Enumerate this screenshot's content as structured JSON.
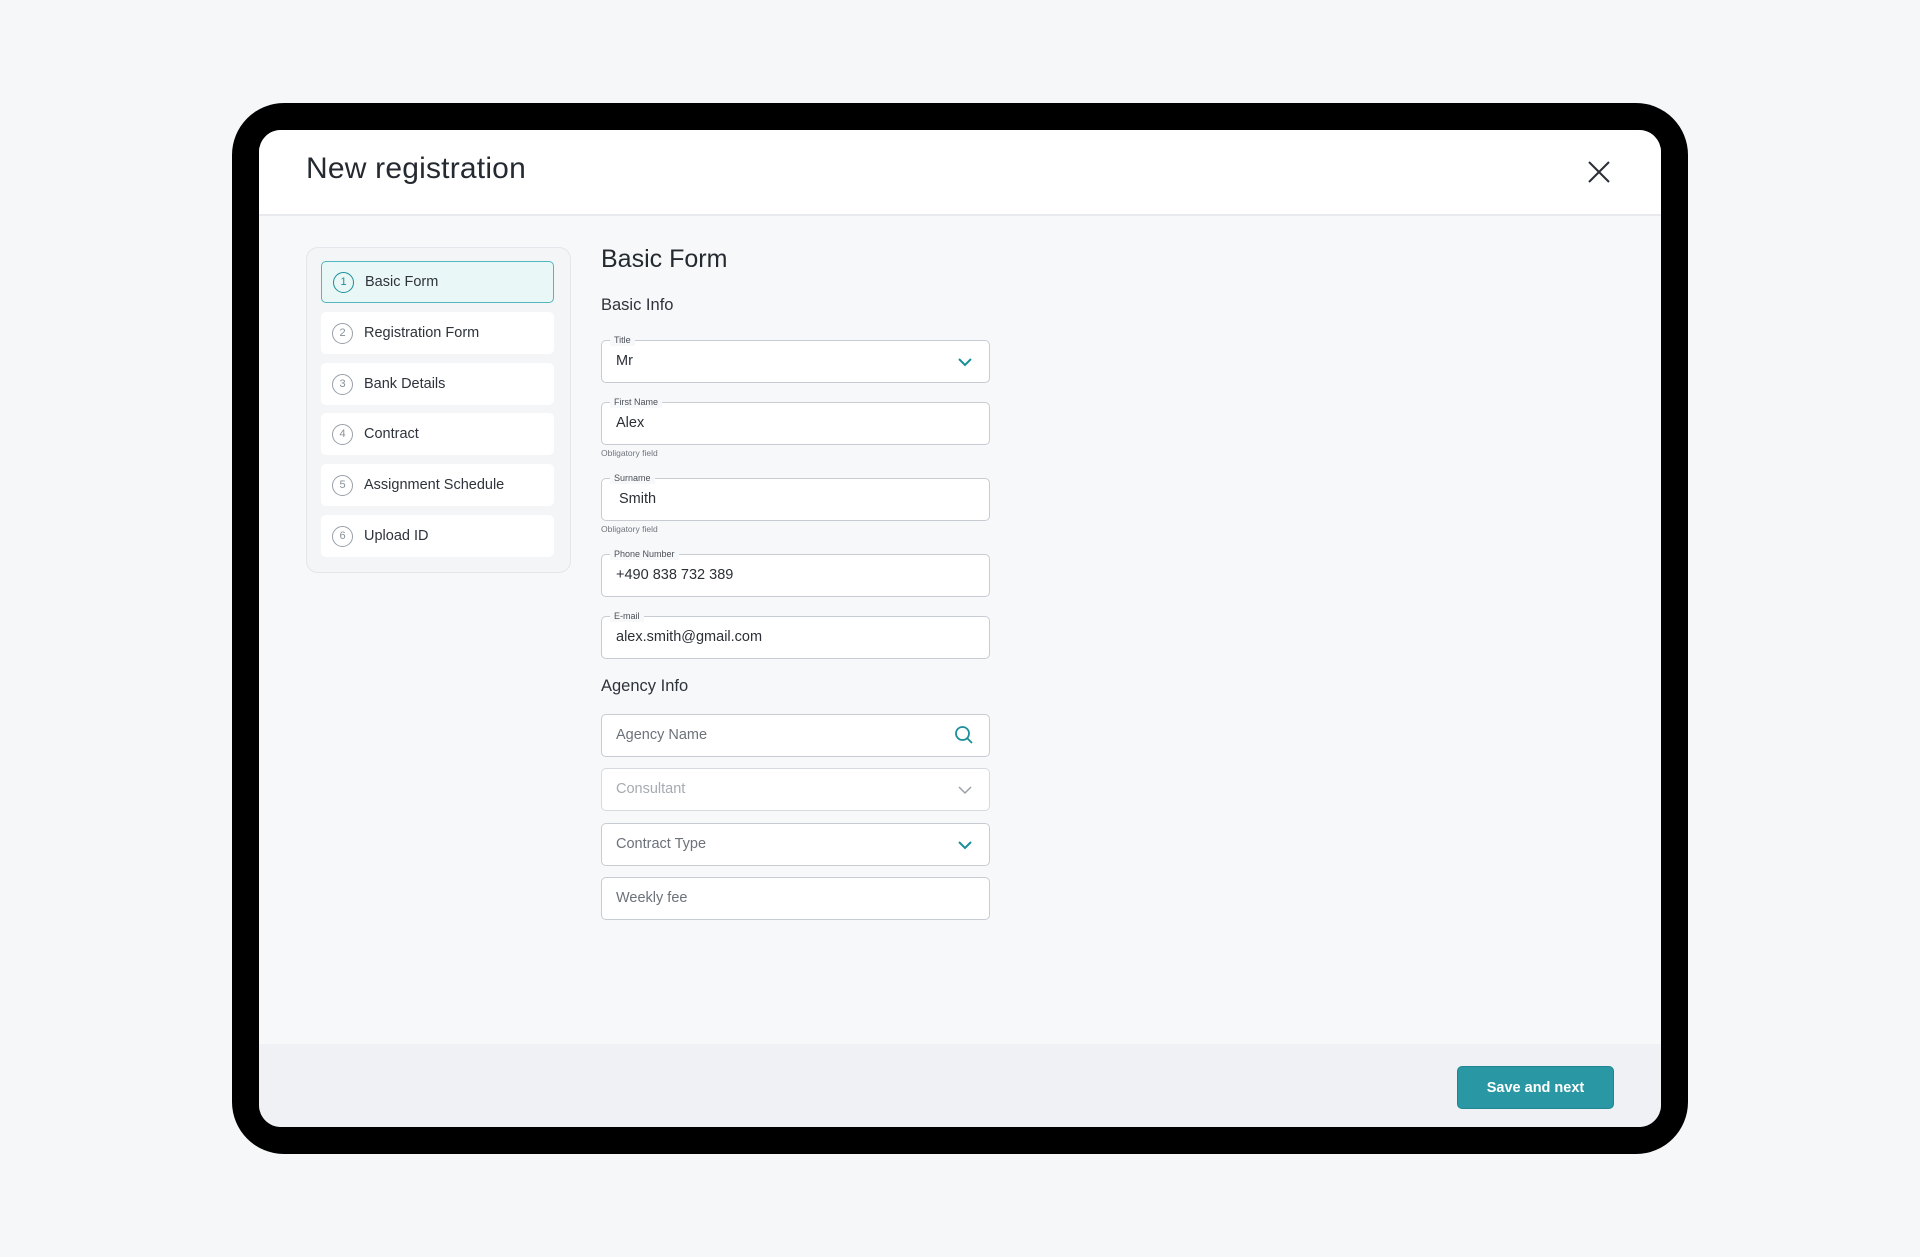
{
  "modal": {
    "title": "New registration"
  },
  "stepper": {
    "steps": [
      {
        "number": "1",
        "label": "Basic Form",
        "active": true
      },
      {
        "number": "2",
        "label": "Registration Form",
        "active": false
      },
      {
        "number": "3",
        "label": "Bank Details",
        "active": false
      },
      {
        "number": "4",
        "label": "Contract",
        "active": false
      },
      {
        "number": "5",
        "label": "Assignment Schedule",
        "active": false
      },
      {
        "number": "6",
        "label": "Upload ID",
        "active": false
      }
    ]
  },
  "form": {
    "title": "Basic Form",
    "basic_info_heading": "Basic Info",
    "title_field": {
      "label": "Title",
      "value": "Mr"
    },
    "first_name": {
      "label": "First Name",
      "value": "Alex",
      "helper": "Obligatory field"
    },
    "surname": {
      "label": "Surname",
      "value": "Smith",
      "helper": "Obligatory field"
    },
    "phone": {
      "label": "Phone Number",
      "value": "+490 838 732 389"
    },
    "email": {
      "label": "E-mail",
      "value": "alex.smith@gmail.com"
    },
    "agency_info_heading": "Agency Info",
    "agency_name": {
      "placeholder": "Agency Name",
      "icon": "search-icon"
    },
    "consultant": {
      "placeholder": "Consultant",
      "icon": "chevron-down-icon"
    },
    "contract_type": {
      "placeholder": "Contract Type",
      "icon": "chevron-down-icon"
    },
    "weekly_fee": {
      "placeholder": "Weekly fee"
    }
  },
  "footer": {
    "primary_label": "Save and next"
  },
  "colors": {
    "accent": "#2a98a4",
    "active_step_bg": "#eaf7f7",
    "device_frame": "#000000"
  }
}
